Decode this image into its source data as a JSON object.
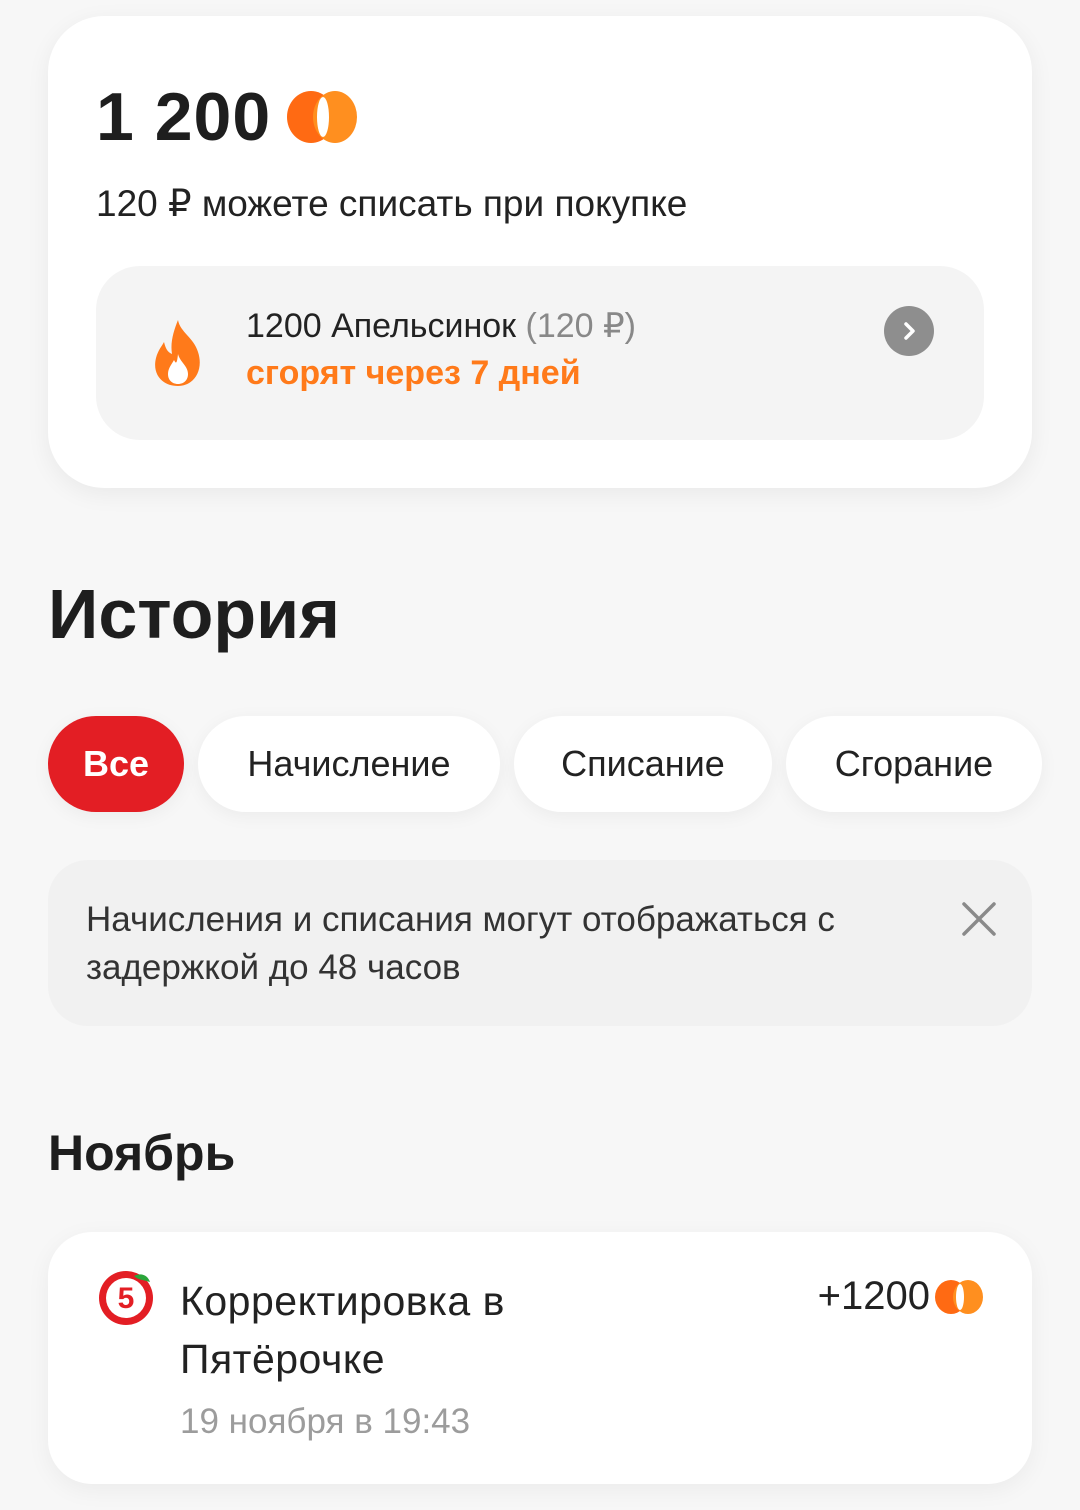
{
  "balance": {
    "amount": "1 200",
    "subtitle": "120 ₽ можете списать при покупке",
    "expire": {
      "points_text": "1200 Апельсинок",
      "rub_text": "(120 ₽)",
      "expire_text": "сгорят через 7 дней"
    }
  },
  "history": {
    "title": "История",
    "filters": [
      "Все",
      "Начисление",
      "Списание",
      "Сгорание"
    ],
    "active_filter": "Все",
    "notice": "Начисления и списания могут отображаться с задержкой до 48 часов"
  },
  "months": [
    {
      "title": "Ноябрь",
      "transactions": [
        {
          "title": "Корректировка в Пятёрочке",
          "date": "19 ноября в 19:43",
          "amount": "+1200"
        }
      ]
    }
  ],
  "colors": {
    "accent_orange": "#ff7a1a",
    "active_chip_red": "#e31e24"
  },
  "icons": {
    "coin": "orange-coin-icon",
    "flame": "flame-icon",
    "chevron": "chevron-right-icon",
    "close": "close-icon",
    "store": "pyaterochka-logo"
  }
}
